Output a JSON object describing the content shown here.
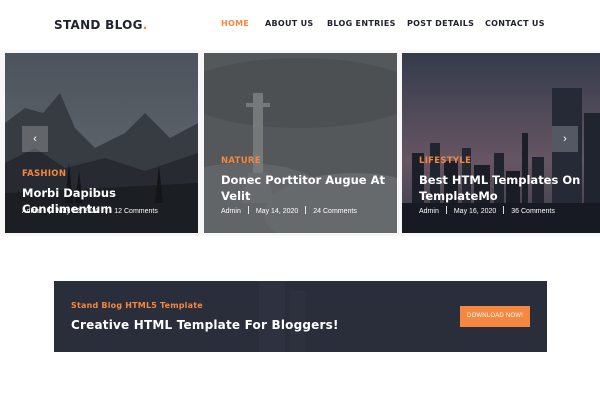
{
  "header": {
    "logo_text": "STAND BLOG",
    "logo_dot": ".",
    "nav": [
      {
        "label": "HOME",
        "active": true
      },
      {
        "label": "ABOUT US",
        "active": false
      },
      {
        "label": "BLOG ENTRIES",
        "active": false
      },
      {
        "label": "POST DETAILS",
        "active": false
      },
      {
        "label": "CONTACT US",
        "active": false
      }
    ]
  },
  "colors": {
    "accent": "#f48840",
    "dark": "#20232e",
    "cta_bg": "#2a2e3a"
  },
  "slider": {
    "prev_icon": "chevron-left-icon",
    "next_icon": "chevron-right-icon",
    "prev_glyph": "‹",
    "next_glyph": "›",
    "slides": [
      {
        "category": "FASHION",
        "title": "Morbi Dapibus Condimentum",
        "author": "Admin",
        "date": "May 12, 2020",
        "comments": "12 Comments",
        "image": "mountain-valley"
      },
      {
        "category": "NATURE",
        "title": "Donec Porttitor Augue At Velit",
        "author": "Admin",
        "date": "May 14, 2020",
        "comments": "24 Comments",
        "image": "statue-in-clouds"
      },
      {
        "category": "LIFESTYLE",
        "title": "Best HTML Templates On TemplateMo",
        "author": "Admin",
        "date": "May 16, 2020",
        "comments": "36 Comments",
        "image": "city-skyline-dusk"
      }
    ]
  },
  "cta": {
    "subtitle": "Stand Blog HTML5 Template",
    "title": "Creative HTML Template For Bloggers!",
    "button_label": "DOWNLOAD NOW!"
  }
}
